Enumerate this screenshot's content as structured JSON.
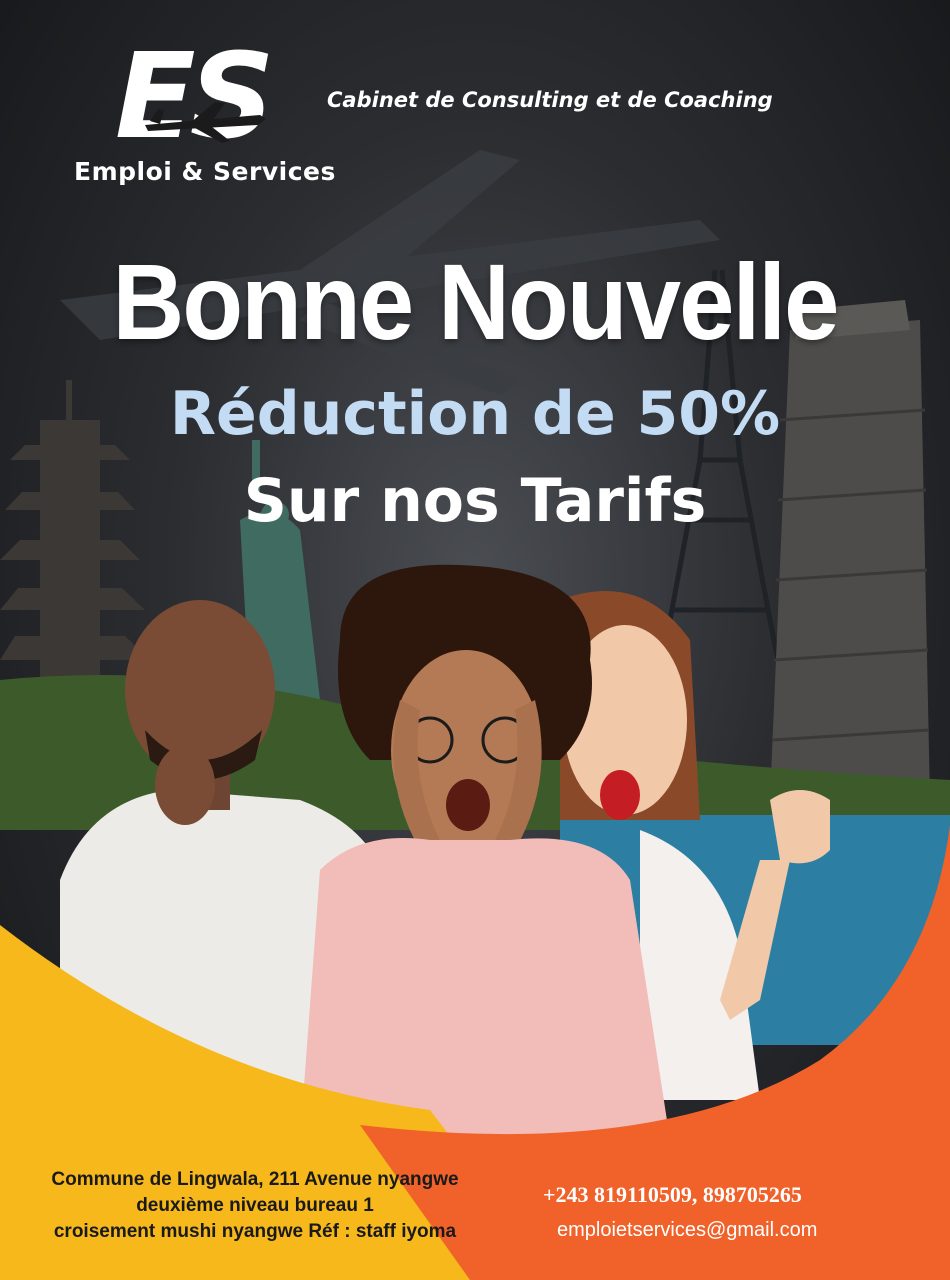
{
  "brand": {
    "logo_letters": "ES",
    "logo_name": "Emploi & Services",
    "tagline": "Cabinet de Consulting et de Coaching"
  },
  "promo": {
    "headline": "Bonne Nouvelle",
    "line1": "Réduction de 50%",
    "line2": "Sur nos Tarifs"
  },
  "contact": {
    "address_lines": [
      "Commune de Lingwala, 211 Avenue nyangwe",
      "deuxième niveau bureau 1",
      "croisement mushi nyangwe Réf : staff iyoma"
    ],
    "phone": "+243 819110509, 898705265",
    "email": "emploietservices@gmail.com"
  },
  "colors": {
    "background_dark": "#2b2d31",
    "accent_yellow": "#f6b81a",
    "accent_orange": "#f0622a",
    "subline_blue": "#c3dcf4",
    "text_white": "#ffffff"
  },
  "icons": [
    "airplane-icon"
  ]
}
